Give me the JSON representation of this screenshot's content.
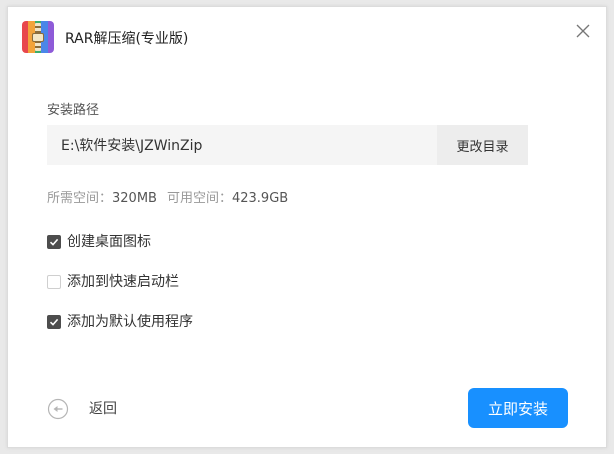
{
  "window": {
    "title": "RAR解压缩(专业版)",
    "app_icon": "rar-archive-icon",
    "close_icon": "close-icon"
  },
  "install_path": {
    "label": "安装路径",
    "value": "E:\\软件安装\\JZWinZip",
    "change_button": "更改目录"
  },
  "space": {
    "required_label": "所需空间：",
    "required_value": "320MB",
    "available_label": "可用空间：",
    "available_value": "423.9GB"
  },
  "options": [
    {
      "label": "创建桌面图标",
      "checked": true
    },
    {
      "label": "添加到快速启动栏",
      "checked": false
    },
    {
      "label": "添加为默认使用程序",
      "checked": true
    }
  ],
  "footer": {
    "back_label": "返回",
    "back_icon": "back-arrow-icon",
    "install_button": "立即安装"
  },
  "colors": {
    "accent": "#1890ff",
    "checkbox_checked": "#4d4d4d",
    "path_background": "#f5f5f5",
    "icon_bands": [
      "#e8474c",
      "#f2a33a",
      "#3cae6a",
      "#4a86e8",
      "#8e5bd8"
    ]
  }
}
